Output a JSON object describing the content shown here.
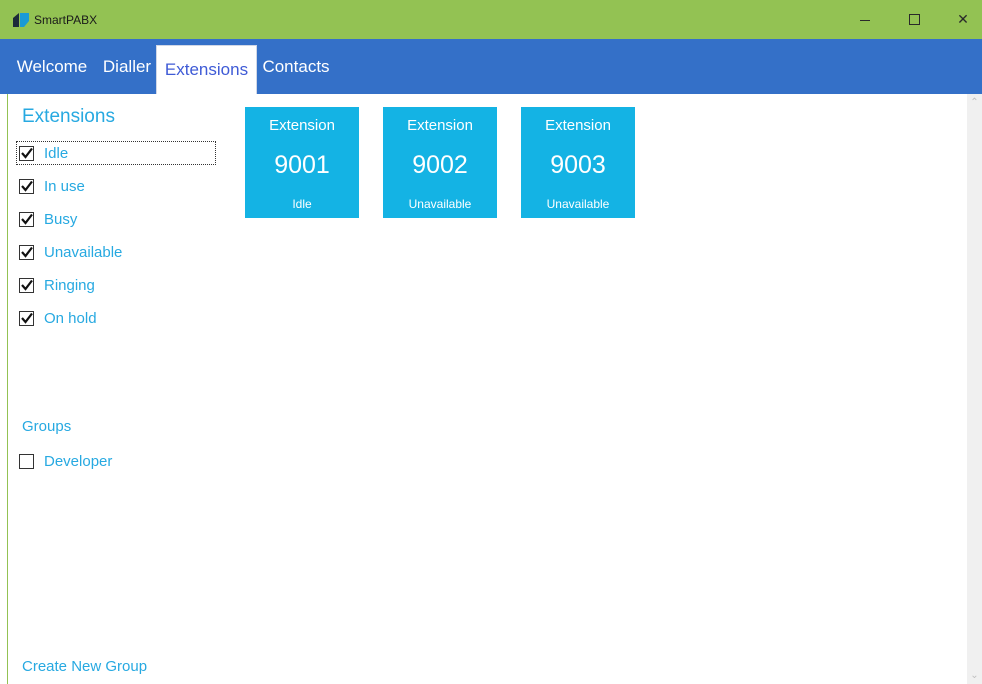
{
  "window": {
    "title": "SmartPABX",
    "minimize_icon": "minimize-icon",
    "maximize_icon": "maximize-icon",
    "close_icon": "close-icon",
    "close_glyph": "✕"
  },
  "colors": {
    "titlebar": "#93c253",
    "tabbar": "#3470c8",
    "accent_text": "#27a9e1",
    "tile": "#14b3e4"
  },
  "tabs": [
    {
      "label": "Welcome"
    },
    {
      "label": "Dialler"
    },
    {
      "label": "Extensions",
      "active": true
    },
    {
      "label": "Contacts"
    }
  ],
  "filters": {
    "title": "Extensions",
    "statuses": [
      {
        "label": "Idle",
        "checked": true
      },
      {
        "label": "In use",
        "checked": true
      },
      {
        "label": "Busy",
        "checked": true
      },
      {
        "label": "Unavailable",
        "checked": true
      },
      {
        "label": "Ringing",
        "checked": true
      },
      {
        "label": "On hold",
        "checked": true
      }
    ],
    "groups_label": "Groups",
    "groups": [
      {
        "label": "Developer",
        "checked": false
      }
    ],
    "create_group_label": "Create New Group"
  },
  "extensions": [
    {
      "heading": "Extension",
      "number": "9001",
      "status": "Idle"
    },
    {
      "heading": "Extension",
      "number": "9002",
      "status": "Unavailable"
    },
    {
      "heading": "Extension",
      "number": "9003",
      "status": "Unavailable"
    }
  ],
  "scrollbar": {
    "up_glyph": "⌃",
    "down_glyph": "⌄"
  }
}
